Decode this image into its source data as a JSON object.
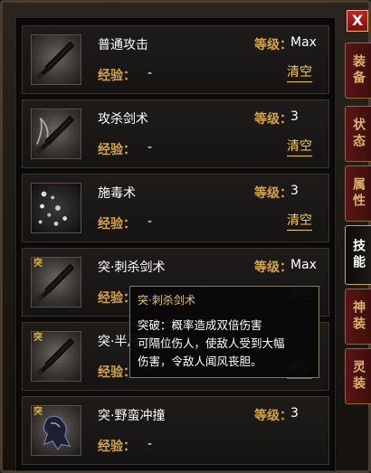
{
  "window": {
    "close_label": "X",
    "tabs": [
      {
        "label": "装备",
        "active": false
      },
      {
        "label": "状态",
        "active": false
      },
      {
        "label": "属性",
        "active": false
      },
      {
        "label": "技能",
        "active": true
      },
      {
        "label": "神装",
        "active": false
      },
      {
        "label": "灵装",
        "active": false
      }
    ]
  },
  "labels": {
    "level": "等级：",
    "exp": "经验：",
    "clear": "清空"
  },
  "skills": [
    {
      "name": "普通攻击",
      "level": "Max",
      "exp": "-",
      "badge": "",
      "icon": "sword-icon",
      "clear_enabled": true
    },
    {
      "name": "攻杀剑术",
      "level": "3",
      "exp": "-",
      "badge": "",
      "icon": "sword-icon",
      "clear_enabled": true
    },
    {
      "name": "施毒术",
      "level": "3",
      "exp": "-",
      "badge": "",
      "icon": "poison-icon",
      "clear_enabled": true
    },
    {
      "name": "突·刺杀剑术",
      "level": "Max",
      "exp": "-",
      "badge": "突",
      "icon": "sword-icon",
      "clear_enabled": false
    },
    {
      "name": "突·半月弯刀",
      "level": "",
      "exp": "-",
      "badge": "突",
      "icon": "sword-icon",
      "clear_enabled": false
    },
    {
      "name": "突·野蛮冲撞",
      "level": "3",
      "exp": "-",
      "badge": "突",
      "icon": "charge-icon",
      "clear_enabled": true
    }
  ],
  "tooltip": {
    "title": "突·刺杀剑术",
    "lines": [
      "突破：概率造成双倍伤害",
      "可隔位伤人，使敌人受到大幅",
      "伤害，令敌人闻风丧胆。"
    ]
  }
}
